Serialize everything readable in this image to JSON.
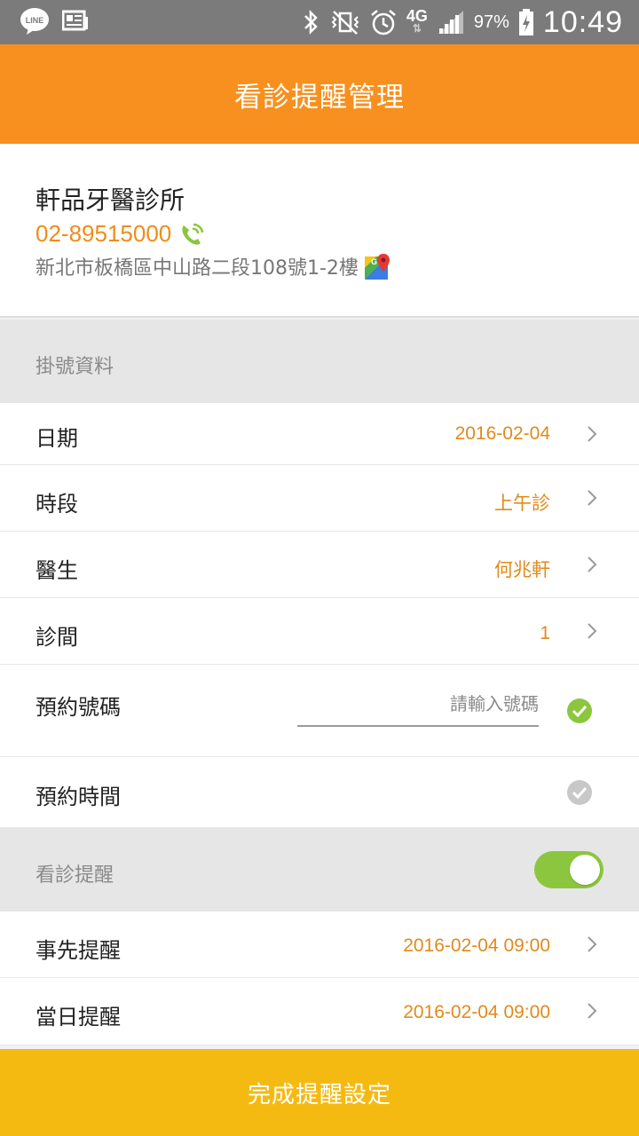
{
  "status_bar": {
    "battery": "97%",
    "time": "10:49",
    "network": "4G",
    "icons": [
      "line-icon",
      "news-icon",
      "bluetooth-icon",
      "vibrate-icon",
      "alarm-icon",
      "signal-icon",
      "battery-icon"
    ]
  },
  "header": {
    "title": "看診提醒管理"
  },
  "clinic": {
    "name": "軒品牙醫診所",
    "phone": "02-89515000",
    "address": "新北市板橋區中山路二段108號1-2樓"
  },
  "registration": {
    "section_title": "掛號資料",
    "date": {
      "label": "日期",
      "value": "2016-02-04"
    },
    "session": {
      "label": "時段",
      "value": "上午診"
    },
    "doctor": {
      "label": "醫生",
      "value": "何兆軒"
    },
    "room": {
      "label": "診間",
      "value": "1"
    },
    "appointment_number": {
      "label": "預約號碼",
      "value": "",
      "placeholder": "請輸入號碼"
    },
    "appointment_time": {
      "label": "預約時間"
    }
  },
  "reminder": {
    "section_title": "看診提醒",
    "enabled": true,
    "advance": {
      "label": "事先提醒",
      "value": "2016-02-04 09:00"
    },
    "same_day": {
      "label": "當日提醒",
      "value": "2016-02-04 09:00"
    }
  },
  "footer": {
    "submit_label": "完成提醒設定"
  },
  "colors": {
    "status_bar": "#7b7b7b",
    "app_bar": "#f7901e",
    "accent_orange": "#e08a1c",
    "toggle_green": "#8cc63f",
    "check_green": "#8cc63f",
    "check_gray": "#c8c8c8",
    "bottom_button": "#f5ba12"
  }
}
